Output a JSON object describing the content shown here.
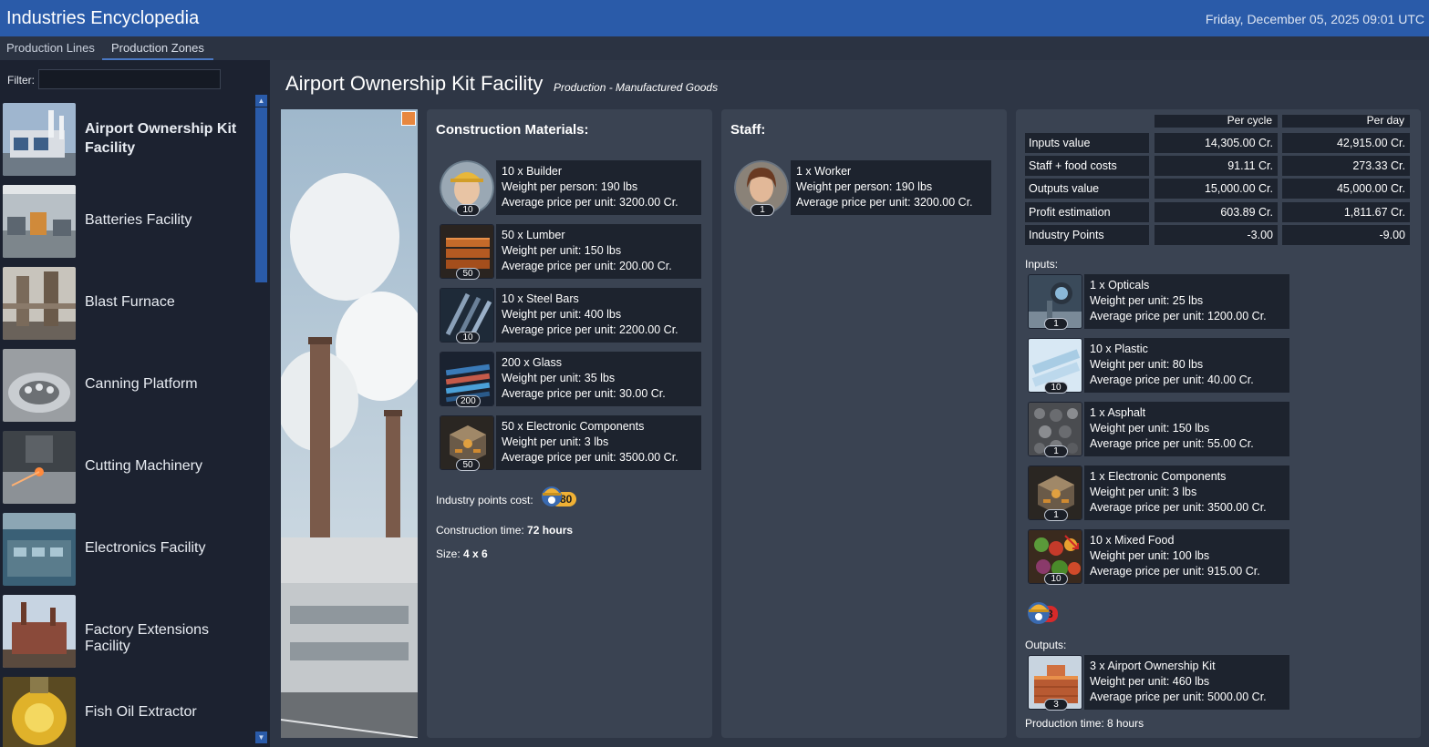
{
  "app": {
    "title": "Industries Encyclopedia",
    "datetime": "Friday, December 05, 2025 09:01 UTC"
  },
  "tabs": [
    {
      "label": "Production Lines",
      "active": false
    },
    {
      "label": "Production Zones",
      "active": true
    }
  ],
  "sidebar": {
    "filter_label": "Filter:",
    "filter_value": "",
    "items": [
      {
        "label": "Airport Ownership Kit Facility",
        "selected": true
      },
      {
        "label": "Batteries Facility"
      },
      {
        "label": "Blast Furnace"
      },
      {
        "label": "Canning Platform"
      },
      {
        "label": "Cutting Machinery"
      },
      {
        "label": "Electronics Facility"
      },
      {
        "label": "Factory Extensions Facility"
      },
      {
        "label": "Fish Oil Extractor"
      }
    ]
  },
  "facility": {
    "title": "Airport Ownership Kit Facility",
    "subtitle": "Production - Manufactured Goods"
  },
  "construction": {
    "title": "Construction Materials:",
    "items": [
      {
        "qty": "10",
        "line1": "10 x Builder",
        "line2": "Weight per person: 190 lbs",
        "line3": "Average price per unit: 3200.00 Cr.",
        "icon": "builder-icon"
      },
      {
        "qty": "50",
        "line1": "50 x Lumber",
        "line2": "Weight per unit: 150 lbs",
        "line3": "Average price per unit: 200.00 Cr.",
        "icon": "lumber-icon"
      },
      {
        "qty": "10",
        "line1": "10 x Steel Bars",
        "line2": "Weight per unit: 400 lbs",
        "line3": "Average price per unit: 2200.00 Cr.",
        "icon": "steel-bars-icon"
      },
      {
        "qty": "200",
        "line1": "200 x Glass",
        "line2": "Weight per unit: 35 lbs",
        "line3": "Average price per unit: 30.00 Cr.",
        "icon": "glass-icon"
      },
      {
        "qty": "50",
        "line1": "50 x Electronic Components",
        "line2": "Weight per unit: 3 lbs",
        "line3": "Average price per unit: 3500.00 Cr.",
        "icon": "electronic-components-icon"
      }
    ],
    "ip_label": "Industry points cost:",
    "ip_value": "80",
    "time_label": "Construction time:",
    "time_value": "72 hours",
    "size_label": "Size:",
    "size_value": "4 x 6"
  },
  "staff": {
    "title": "Staff:",
    "items": [
      {
        "qty": "1",
        "line1": "1 x Worker",
        "line2": "Weight per person: 190 lbs",
        "line3": "Average price per unit: 3200.00 Cr.",
        "icon": "worker-icon"
      }
    ]
  },
  "economy": {
    "col_cycle": "Per cycle",
    "col_day": "Per day",
    "rows": [
      {
        "label": "Inputs value",
        "cycle": "14,305.00 Cr.",
        "day": "42,915.00 Cr."
      },
      {
        "label": "Staff + food costs",
        "cycle": "91.11 Cr.",
        "day": "273.33 Cr."
      },
      {
        "label": "Outputs value",
        "cycle": "15,000.00 Cr.",
        "day": "45,000.00 Cr."
      },
      {
        "label": "Profit estimation",
        "cycle": "603.89 Cr.",
        "day": "1,811.67 Cr."
      },
      {
        "label": "Industry Points",
        "cycle": "-3.00",
        "day": "-9.00"
      }
    ],
    "inputs_label": "Inputs:",
    "inputs": [
      {
        "qty": "1",
        "line1": "1 x Opticals",
        "line2": "Weight per unit: 25 lbs",
        "line3": "Average price per unit: 1200.00 Cr.",
        "icon": "optics-icon"
      },
      {
        "qty": "10",
        "line1": "10 x Plastic",
        "line2": "Weight per unit: 80 lbs",
        "line3": "Average price per unit: 40.00 Cr.",
        "icon": "plastic-icon"
      },
      {
        "qty": "1",
        "line1": "1 x Asphalt",
        "line2": "Weight per unit: 150 lbs",
        "line3": "Average price per unit: 55.00 Cr.",
        "icon": "asphalt-icon"
      },
      {
        "qty": "1",
        "line1": "1 x Electronic Components",
        "line2": "Weight per unit: 3 lbs",
        "line3": "Average price per unit: 3500.00 Cr.",
        "icon": "electronic-components-icon"
      },
      {
        "qty": "10",
        "line1": "10 x Mixed Food",
        "line2": "Weight per unit: 100 lbs",
        "line3": "Average price per unit: 915.00 Cr.",
        "icon": "mixed-food-icon"
      }
    ],
    "ip_badge_value": "3",
    "outputs_label": "Outputs:",
    "outputs": [
      {
        "qty": "3",
        "line1": "3 x Airport Ownership Kit",
        "line2": "Weight per unit: 460 lbs",
        "line3": "Average price per unit: 5000.00 Cr.",
        "icon": "airport-kit-icon"
      }
    ],
    "production_time": "Production time: 8 hours"
  },
  "colors": {
    "titlebar": "#2a5ba9",
    "panel": "#3a4352",
    "cell": "#1d232e",
    "ip_gold": "#f0b135",
    "ip_red": "#d72a2a",
    "flag": "#e8873f"
  }
}
